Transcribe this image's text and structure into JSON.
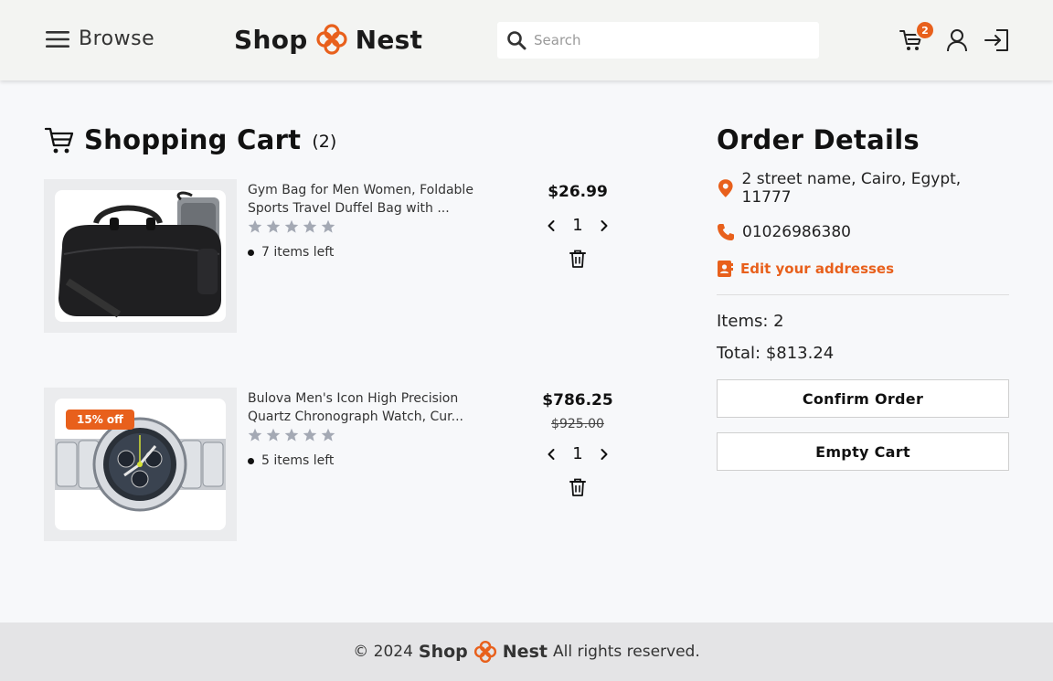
{
  "header": {
    "browse_label": "Browse",
    "logo_left": "Shop",
    "logo_right": "Nest",
    "search_placeholder": "Search",
    "cart_count": "2",
    "accent_color": "#e8601c"
  },
  "cart": {
    "title": "Shopping Cart",
    "count": "(2)",
    "items": [
      {
        "name": "Gym Bag for Men Women, Foldable Sports Travel Duffel Bag with ...",
        "price": "$26.99",
        "old_price": "",
        "discount": "",
        "stock": "7 items left",
        "quantity": "1",
        "rating": 0
      },
      {
        "name": "Bulova Men's Icon High Precision Quartz Chronograph Watch, Cur...",
        "price": "$786.25",
        "old_price": "$925.00",
        "discount": "15% off",
        "stock": "5 items left",
        "quantity": "1",
        "rating": 0
      }
    ]
  },
  "order": {
    "title": "Order Details",
    "address": "2 street name, Cairo, Egypt, 11777",
    "phone": "01026986380",
    "edit_link": "Edit your addresses",
    "items_label": "Items: 2",
    "total_label": "Total: $813.24",
    "confirm_button": "Confirm Order",
    "empty_button": "Empty Cart"
  },
  "footer": {
    "copyright": "© 2024",
    "logo_left": "Shop",
    "logo_right": "Nest",
    "rights": "All rights reserved."
  }
}
